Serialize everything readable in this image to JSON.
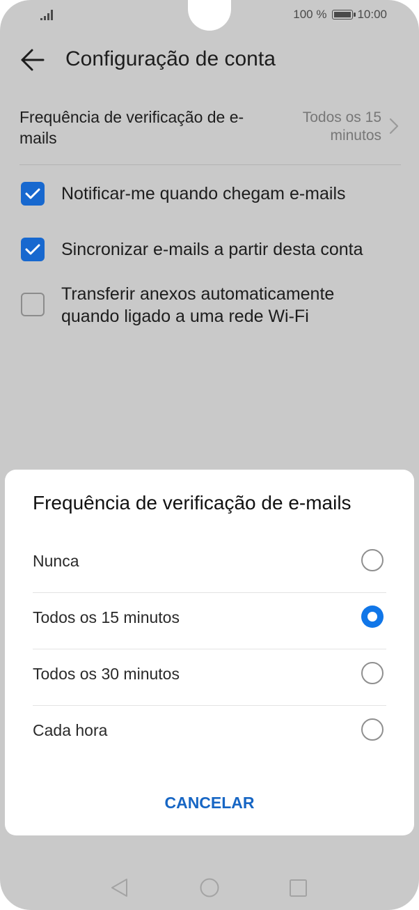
{
  "status_bar": {
    "battery_percent": "100 %",
    "time": "10:00"
  },
  "app_bar": {
    "title": "Configuração de conta",
    "back_icon": "arrow-left-icon"
  },
  "settings": {
    "frequency": {
      "label": "Frequência de verificação de e-mails",
      "value": "Todos os 15 minutos"
    },
    "checkboxes": [
      {
        "label": "Notificar-me quando chegam e-mails",
        "checked": true
      },
      {
        "label": "Sincronizar e-mails a partir desta conta",
        "checked": true
      },
      {
        "label": "Transferir anexos automaticamente quando ligado a uma rede Wi-Fi",
        "checked": false
      }
    ]
  },
  "dialog": {
    "title": "Frequência de verificação de e-mails",
    "options": [
      {
        "label": "Nunca",
        "selected": false
      },
      {
        "label": "Todos os 15 minutos",
        "selected": true
      },
      {
        "label": "Todos os 30 minutos",
        "selected": false
      },
      {
        "label": "Cada hora",
        "selected": false
      }
    ],
    "cancel_label": "CANCELAR"
  },
  "nav_bar": {
    "icons": [
      "back-triangle-icon",
      "home-circle-icon",
      "recents-square-icon"
    ]
  },
  "colors": {
    "accent": "#1076e8",
    "checkbox": "#1768cf",
    "overlay_background": "#c9c9c9",
    "cancel_text": "#1766c4"
  }
}
